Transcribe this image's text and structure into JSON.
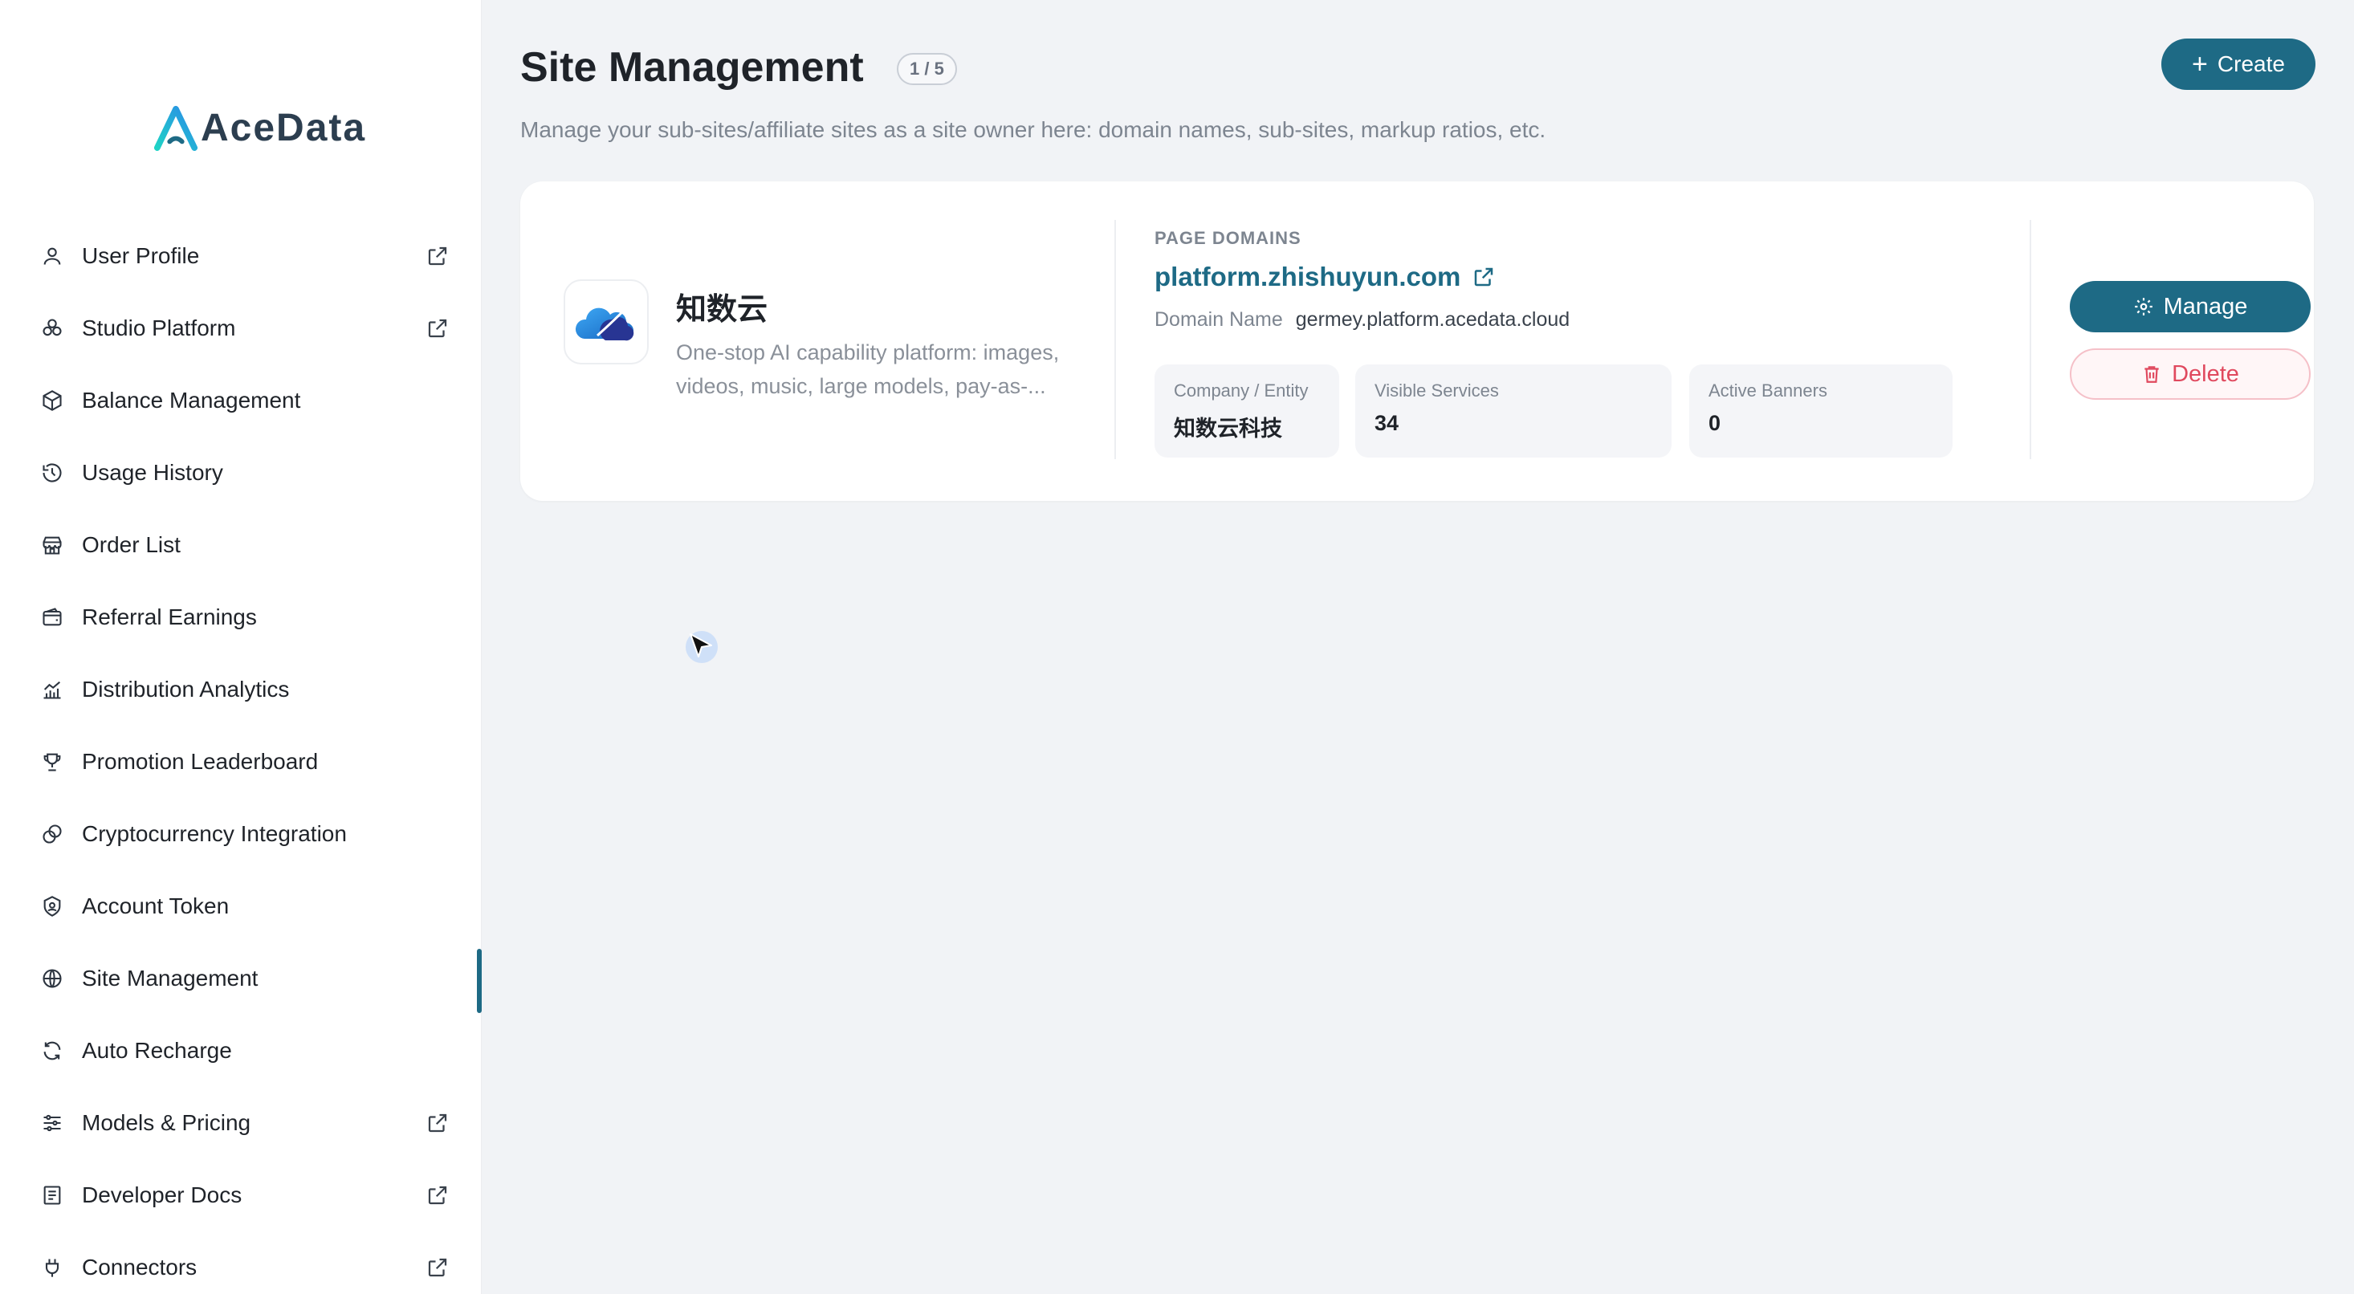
{
  "brand": {
    "name": "AceData",
    "accent": "#1e6a85"
  },
  "sidebar": {
    "items": [
      {
        "label": "User Profile",
        "icon": "user-icon",
        "external": true
      },
      {
        "label": "Studio Platform",
        "icon": "studio-icon",
        "external": true
      },
      {
        "label": "Balance Management",
        "icon": "box-icon",
        "external": false
      },
      {
        "label": "Usage History",
        "icon": "history-icon",
        "external": false
      },
      {
        "label": "Order List",
        "icon": "store-icon",
        "external": false
      },
      {
        "label": "Referral Earnings",
        "icon": "wallet-icon",
        "external": false
      },
      {
        "label": "Distribution Analytics",
        "icon": "chart-icon",
        "external": false
      },
      {
        "label": "Promotion Leaderboard",
        "icon": "trophy-icon",
        "external": false
      },
      {
        "label": "Cryptocurrency Integration",
        "icon": "crypto-icon",
        "external": false
      },
      {
        "label": "Account Token",
        "icon": "shield-icon",
        "external": false
      },
      {
        "label": "Site Management",
        "icon": "globe-icon",
        "external": false,
        "active": true
      },
      {
        "label": "Auto Recharge",
        "icon": "refresh-icon",
        "external": false
      },
      {
        "label": "Models & Pricing",
        "icon": "sliders-icon",
        "external": true
      },
      {
        "label": "Developer Docs",
        "icon": "docs-icon",
        "external": true
      },
      {
        "label": "Connectors",
        "icon": "plug-icon",
        "external": true
      }
    ]
  },
  "header": {
    "title": "Site Management",
    "count": "1 / 5",
    "subtitle": "Manage your sub-sites/affiliate sites as a site owner here: domain names, sub-sites, markup ratios, etc.",
    "create_label": "Create"
  },
  "site": {
    "name": "知数云",
    "description": "One-stop AI capability platform: images, videos, music, large models, pay-as-...",
    "domains_label": "PAGE DOMAINS",
    "domain": "platform.zhishuyun.com",
    "domain_name_key": "Domain Name",
    "domain_name_value": "germey.platform.acedata.cloud",
    "stats": [
      {
        "label": "Company / Entity",
        "value": "知数云科技"
      },
      {
        "label": "Visible Services",
        "value": "34"
      },
      {
        "label": "Active Banners",
        "value": "0"
      }
    ],
    "manage_label": "Manage",
    "delete_label": "Delete"
  }
}
